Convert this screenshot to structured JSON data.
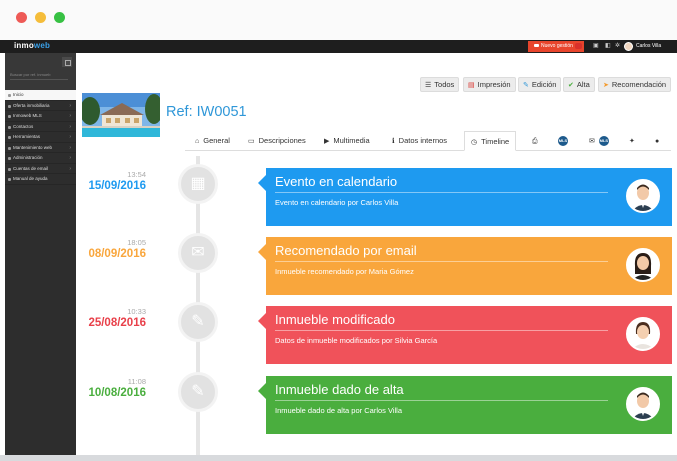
{
  "app": {
    "logo_a": "inmo",
    "logo_b": "web",
    "new_button": "Nuevo gestión",
    "user_name": "Carlos Villa"
  },
  "sidebar": {
    "search_placeholder": "Buscar por ref. inmueb",
    "items": [
      {
        "label": "Inicio",
        "active": true
      },
      {
        "label": "Oferta inmobiliaria"
      },
      {
        "label": "Inmoweb MLS"
      },
      {
        "label": "Contactos"
      },
      {
        "label": "Herramientas"
      },
      {
        "label": "Mantenimiento web"
      },
      {
        "label": "Administración"
      },
      {
        "label": "Cuentas de email"
      },
      {
        "label": "Manual de ayuda"
      }
    ]
  },
  "toolbar": {
    "todos": "Todos",
    "impresion": "Impresión",
    "edicion": "Edición",
    "alta": "Alta",
    "recomendacion": "Recomendación"
  },
  "property": {
    "ref": "Ref: IW0051"
  },
  "tabs": {
    "general": "General",
    "descripciones": "Descripciones",
    "multimedia": "Multimedia",
    "datos_internos": "Datos internos",
    "timeline": "Timeline",
    "ms_label": "MLS"
  },
  "timeline": [
    {
      "time": "13:54",
      "date": "15/09/2016",
      "title": "Evento en calendario",
      "desc": "Evento en calendario por Carlos Villa",
      "color": "#1e9af0",
      "icon": "calendar-icon"
    },
    {
      "time": "18:05",
      "date": "08/09/2016",
      "title": "Recomendado por email",
      "desc": "Inmueble recomendado por Maria Gómez",
      "color": "#f9a63c",
      "icon": "envelope-icon"
    },
    {
      "time": "10:33",
      "date": "25/08/2016",
      "title": "Inmueble modificado",
      "desc": "Datos de inmueble modificados por Silvia García",
      "color": "#f0525a",
      "icon": "edit-icon"
    },
    {
      "time": "11:08",
      "date": "10/08/2016",
      "title": "Inmueble dado de alta",
      "desc": "Inmueble dado de alta por Carlos Villa",
      "color": "#4aae3e",
      "icon": "edit-icon"
    }
  ],
  "colors": {
    "accent": "#2f97d8",
    "sidebar": "#2d2d2d",
    "topbar": "#1e1e1e",
    "new_button": "#e8452c"
  }
}
